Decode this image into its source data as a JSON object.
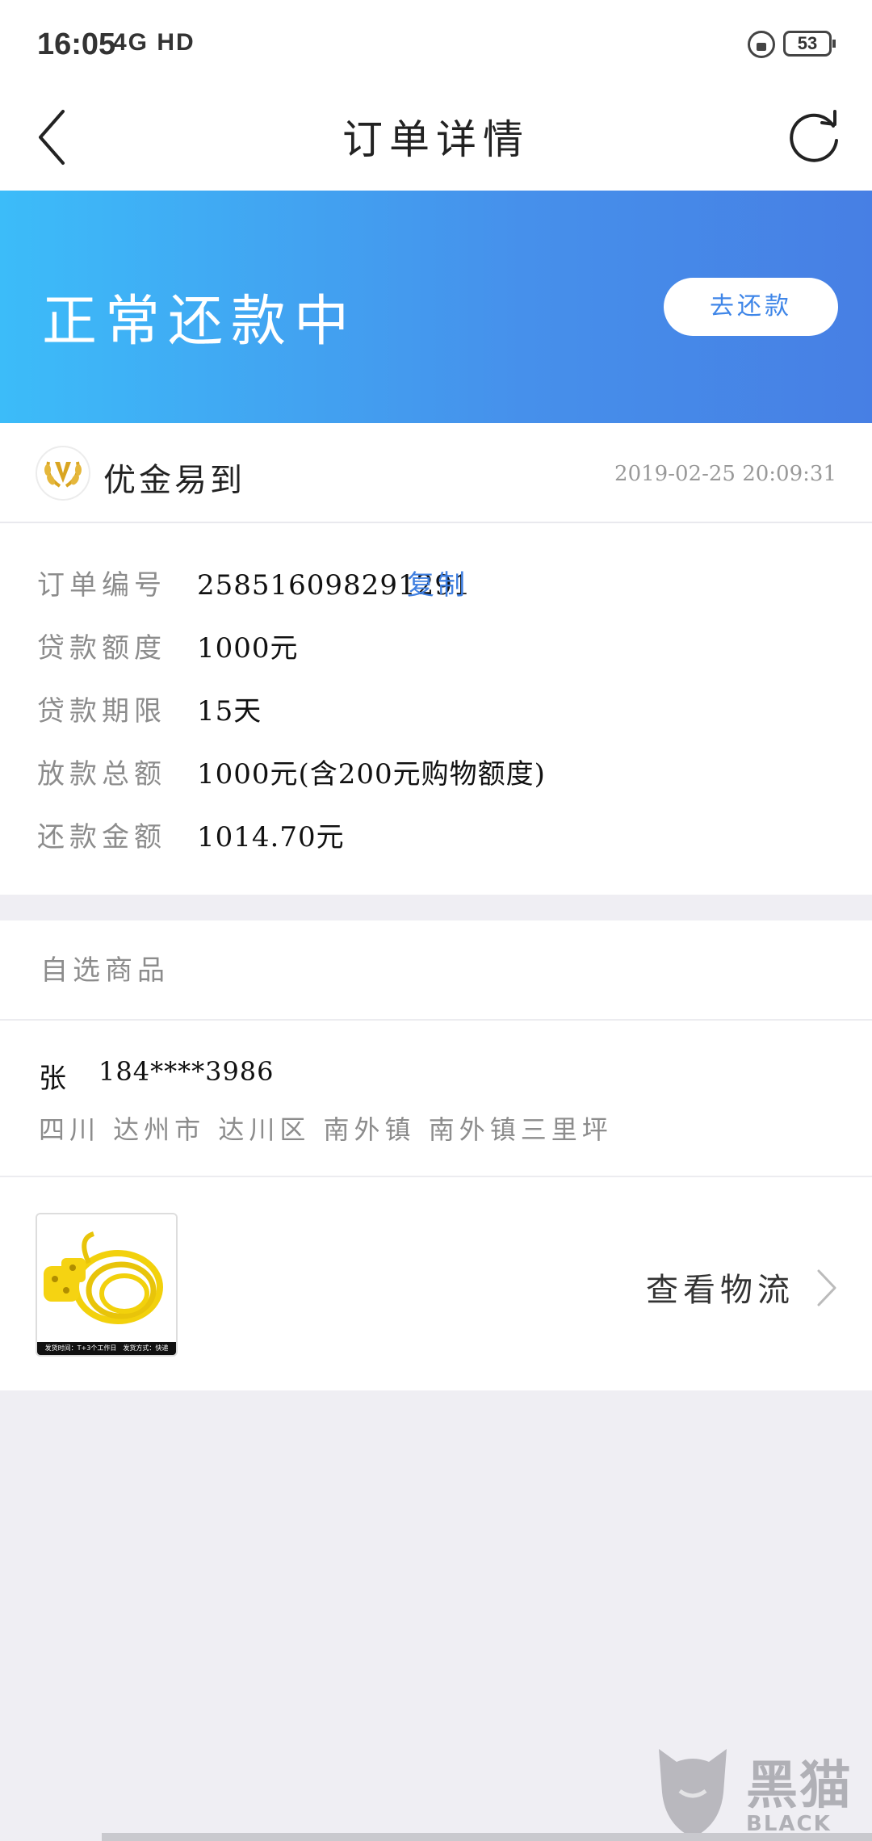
{
  "status_bar": {
    "time": "16:05",
    "signal": "4G HD",
    "battery": "53"
  },
  "nav": {
    "title": "订单详情",
    "back_icon": "chevron-left-icon",
    "refresh_icon": "refresh-icon"
  },
  "banner": {
    "status_text": "正常还款中",
    "repay_button": "去还款",
    "gradient_start": "#3cbcf9",
    "gradient_end": "#477fe4"
  },
  "merchant": {
    "name": "优金易到",
    "time": "2019-02-25 20:09:31"
  },
  "details": {
    "rows": [
      {
        "label": "订单编号",
        "value": "258516098291291"
      },
      {
        "label": "贷款额度",
        "value": "1000元"
      },
      {
        "label": "贷款期限",
        "value": "15天"
      },
      {
        "label": "放款总额",
        "value": "1000元(含200元购物额度)"
      },
      {
        "label": "还款金额",
        "value": "1014.70元"
      }
    ],
    "copy_label": "复制",
    "accent_color": "#3f7fe0"
  },
  "goods": {
    "header": "自选商品",
    "recipient_name": "张",
    "recipient_phone": "184****3986",
    "address": "四川 达州市 达川区 南外镇 南外镇三里坪",
    "product_caption": "发货时间：T+3个工作日　发货方式：快递",
    "logistics_label": "查看物流"
  },
  "watermark": {
    "main": "黑猫",
    "sub": "BLACK CAT"
  }
}
